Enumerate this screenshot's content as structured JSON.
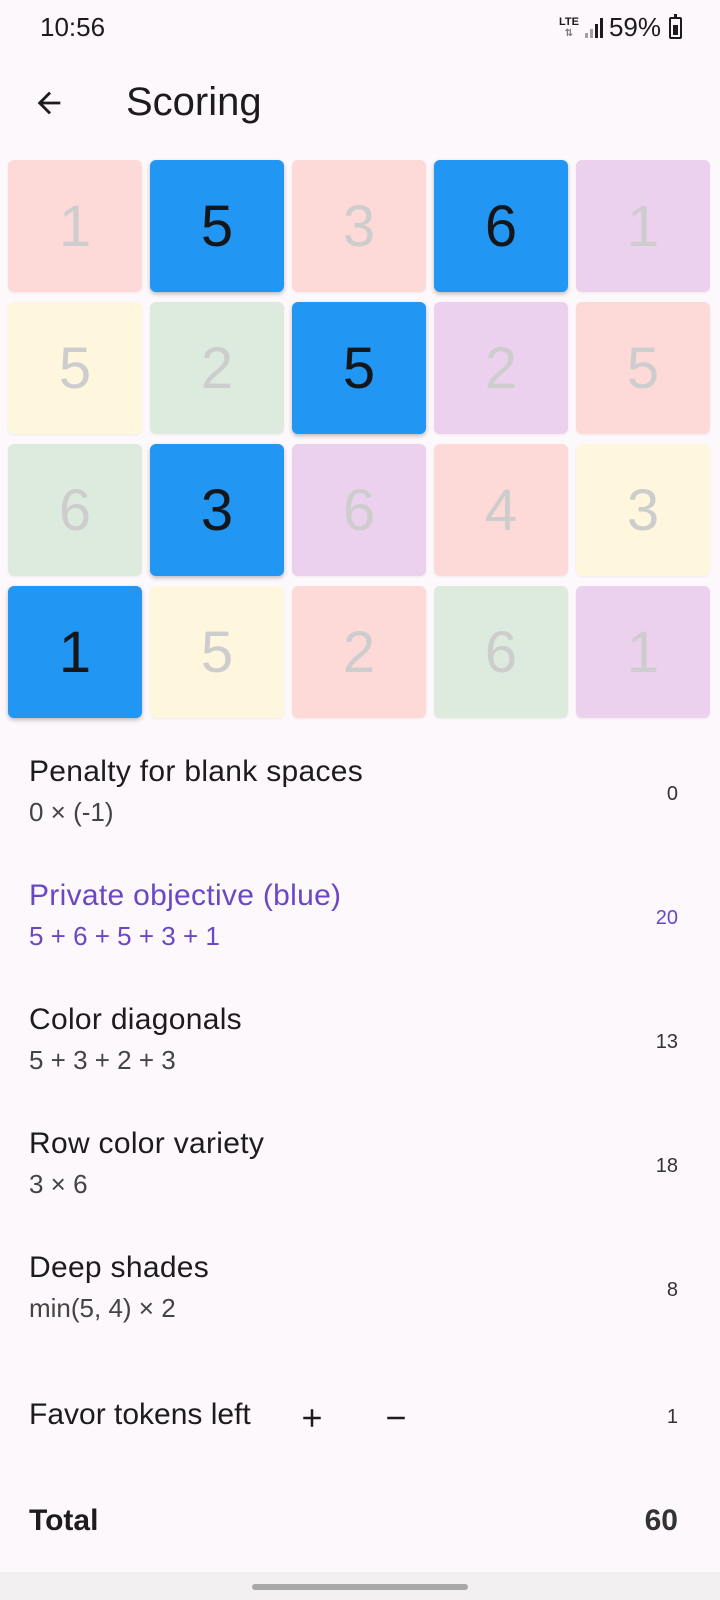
{
  "status": {
    "time": "10:56",
    "network": "LTE",
    "battery": "59%"
  },
  "appbar": {
    "title": "Scoring",
    "back_icon": "arrow-left-icon"
  },
  "colors": {
    "red": "#fdd9d7",
    "yellow": "#fef7dd",
    "green": "#dcebde",
    "purple": "#ebd1ee",
    "blue": "#2196f3",
    "accent": "#6b47c6"
  },
  "grid": [
    [
      {
        "value": "1",
        "color": "red",
        "selected": false
      },
      {
        "value": "5",
        "color": "blue",
        "selected": true
      },
      {
        "value": "3",
        "color": "red",
        "selected": false
      },
      {
        "value": "6",
        "color": "blue",
        "selected": true
      },
      {
        "value": "1",
        "color": "purple",
        "selected": false
      }
    ],
    [
      {
        "value": "5",
        "color": "yellow",
        "selected": false
      },
      {
        "value": "2",
        "color": "green",
        "selected": false
      },
      {
        "value": "5",
        "color": "blue",
        "selected": true
      },
      {
        "value": "2",
        "color": "purple",
        "selected": false
      },
      {
        "value": "5",
        "color": "red",
        "selected": false
      }
    ],
    [
      {
        "value": "6",
        "color": "green",
        "selected": false
      },
      {
        "value": "3",
        "color": "blue",
        "selected": true
      },
      {
        "value": "6",
        "color": "purple",
        "selected": false
      },
      {
        "value": "4",
        "color": "red",
        "selected": false
      },
      {
        "value": "3",
        "color": "yellow",
        "selected": false
      }
    ],
    [
      {
        "value": "1",
        "color": "blue",
        "selected": true
      },
      {
        "value": "5",
        "color": "yellow",
        "selected": false
      },
      {
        "value": "2",
        "color": "red",
        "selected": false
      },
      {
        "value": "6",
        "color": "green",
        "selected": false
      },
      {
        "value": "1",
        "color": "purple",
        "selected": false
      }
    ]
  ],
  "scores": [
    {
      "title": "Penalty for blank spaces",
      "detail": "0 × (-1)",
      "value": "0",
      "active": false
    },
    {
      "title": "Private objective (blue)",
      "detail": "5 + 6 + 5 + 3 + 1",
      "value": "20",
      "active": true
    },
    {
      "title": "Color diagonals",
      "detail": "5 + 3 + 2 + 3",
      "value": "13",
      "active": false
    },
    {
      "title": "Row color variety",
      "detail": "3 × 6",
      "value": "18",
      "active": false
    },
    {
      "title": "Deep shades",
      "detail": "min(5, 4) × 2",
      "value": "8",
      "active": false
    }
  ],
  "favor": {
    "label": "Favor tokens left",
    "value": "1",
    "plus_icon": "plus-icon",
    "minus_icon": "minus-icon"
  },
  "total": {
    "label": "Total",
    "value": "60"
  }
}
